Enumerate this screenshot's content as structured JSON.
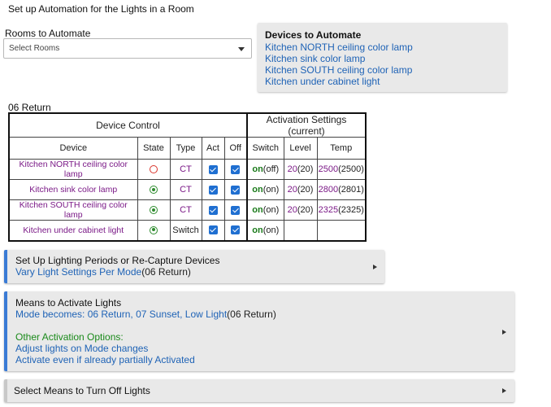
{
  "page_title": "Set up Automation for the Lights in a Room",
  "rooms": {
    "label": "Rooms to Automate",
    "placeholder": "Select Rooms"
  },
  "devices_box": {
    "title": "Devices to Automate",
    "devices": [
      "Kitchen NORTH ceiling color lamp",
      "Kitchen sink color lamp",
      "Kitchen SOUTH ceiling color lamp",
      "Kitchen under cabinet light"
    ]
  },
  "mode_label": "06 Return",
  "table": {
    "group_headers": [
      "Device Control",
      "Activation Settings (current)"
    ],
    "columns": [
      "Device",
      "State",
      "Type",
      "Act",
      "Off",
      "Switch",
      "Level",
      "Temp"
    ],
    "rows": [
      {
        "device": "Kitchen NORTH ceiling color lamp",
        "state": "off",
        "type": "CT",
        "act": true,
        "off": true,
        "switch_on": "on",
        "switch_cur": "(off)",
        "level": "20",
        "level_cur": "(20)",
        "temp": "2500",
        "temp_cur": "(2500)"
      },
      {
        "device": "Kitchen sink color lamp",
        "state": "on",
        "type": "CT",
        "act": true,
        "off": true,
        "switch_on": "on",
        "switch_cur": "(on)",
        "level": "20",
        "level_cur": "(20)",
        "temp": "2800",
        "temp_cur": "(2801)"
      },
      {
        "device": "Kitchen SOUTH ceiling color lamp",
        "state": "on",
        "type": "CT",
        "act": true,
        "off": true,
        "switch_on": "on",
        "switch_cur": "(on)",
        "level": "20",
        "level_cur": "(20)",
        "temp": "2325",
        "temp_cur": "(2325)"
      },
      {
        "device": "Kitchen under cabinet light",
        "state": "on",
        "type": "Switch",
        "act": true,
        "off": true,
        "switch_on": "on",
        "switch_cur": "(on)",
        "level": "",
        "level_cur": "",
        "temp": "",
        "temp_cur": ""
      }
    ]
  },
  "sections": {
    "lighting_periods": {
      "title": "Set Up Lighting Periods or Re-Capture Devices",
      "link": "Vary Light Settings Per Mode",
      "link_suffix": "(06 Return)"
    },
    "activate": {
      "title": "Means to Activate Lights",
      "link": "Mode becomes: 06 Return, 07 Sunset, Low Light",
      "link_suffix": "(06 Return)",
      "other_label": "Other Activation Options:",
      "options": [
        "Adjust lights on Mode changes",
        "Activate even if already partially Activated"
      ]
    },
    "turn_off": {
      "title": "Select Means to Turn Off Lights"
    }
  },
  "colors": {
    "link_blue": "#1f63b6",
    "device_purple": "#7b1a87",
    "on_green": "#1a7a1a",
    "accent_bar": "#3a7bd5",
    "panel_gray": "#e9e9e9"
  }
}
